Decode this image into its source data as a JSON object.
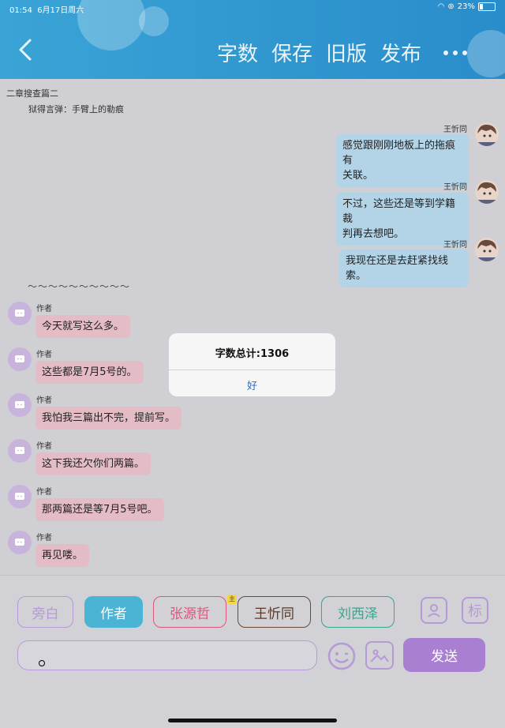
{
  "status": {
    "time": "01:54",
    "date": "6月17日周六",
    "battery": "23%",
    "battery_level": 0.23
  },
  "header": {
    "nav": [
      "字数",
      "保存",
      "旧版",
      "发布"
    ]
  },
  "chapter": {
    "title": "二章搜查篇二",
    "subtitle": "狱得言弹：手臂上的勒痕"
  },
  "messages_right": [
    {
      "name": "王忻同",
      "lines": [
        "感觉跟刚刚地板上的拖痕有",
        "关联。"
      ]
    },
    {
      "name": "王忻同",
      "lines": [
        "不过，这些还是等到学籍裁",
        "判再去想吧。"
      ]
    },
    {
      "name": "王忻同",
      "lines": [
        "我现在还是去赶紧找线索。"
      ]
    }
  ],
  "separator": "～～～～～～～～～～",
  "messages_left": [
    {
      "name": "作者",
      "text": "今天就写这么多。"
    },
    {
      "name": "作者",
      "text": "这些都是7月5号的。"
    },
    {
      "name": "作者",
      "text": "我怕我三篇出不完，提前写。"
    },
    {
      "name": "作者",
      "text": "这下我还欠你们两篇。"
    },
    {
      "name": "作者",
      "text": "那两篇还是等7月5号吧。"
    },
    {
      "name": "作者",
      "text": "再见喽。"
    }
  ],
  "dialog": {
    "title": "字数总计:1306",
    "ok": "好"
  },
  "roles": [
    "旁白",
    "作者",
    "张源哲",
    "王忻同",
    "刘西泽"
  ],
  "crown_label": "主",
  "icons": {
    "tag_label": "标",
    "emoji": "smile-icon",
    "image": "image-icon",
    "person": "person-icon"
  },
  "input": {
    "value": ""
  },
  "send_label": "发送",
  "colors": {
    "header": "#2f95cf",
    "send": "#a97fd2",
    "bubble_blue": "#b3d3e6",
    "bubble_pink": "#e4bcc5"
  }
}
